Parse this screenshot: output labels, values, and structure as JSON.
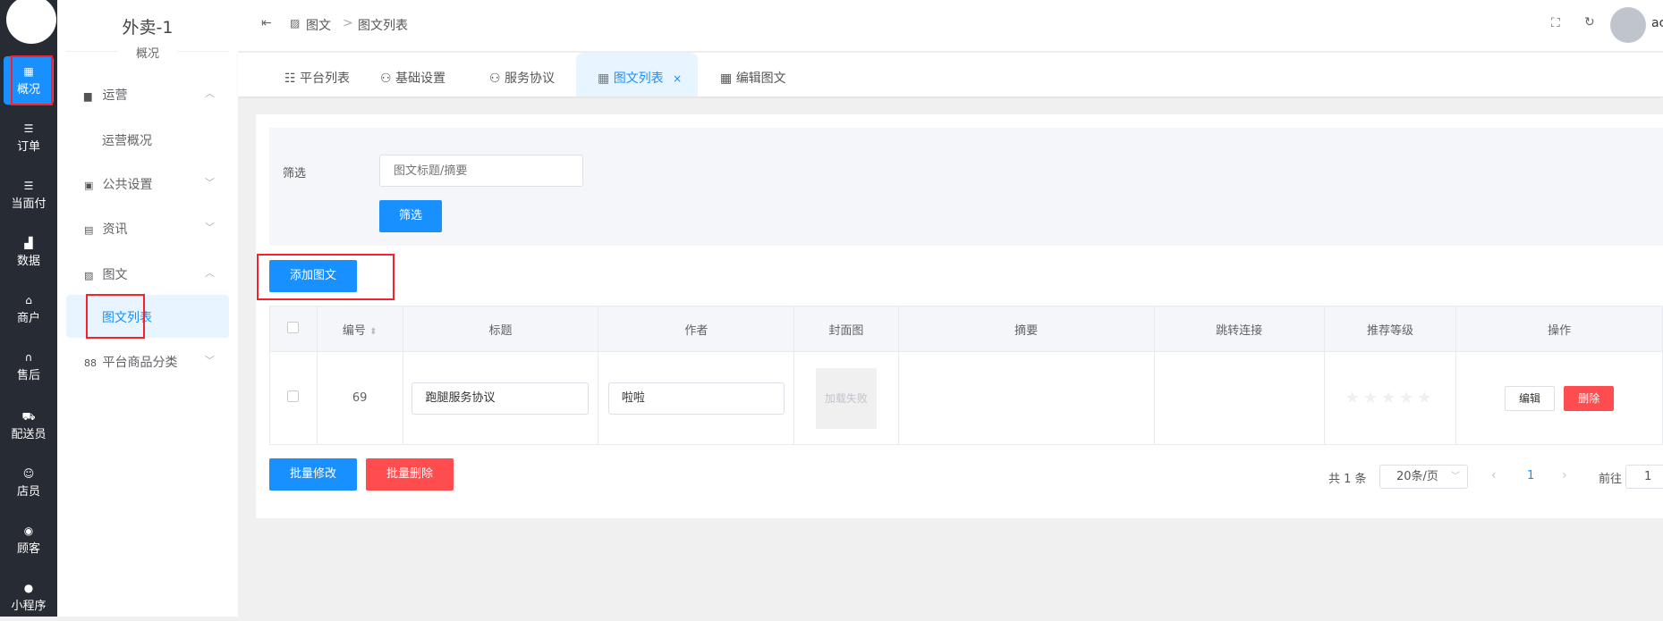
{
  "nav": {
    "items": [
      {
        "label": "概况",
        "icon": "dashboard-icon"
      },
      {
        "label": "订单",
        "icon": "list-icon"
      },
      {
        "label": "当面付",
        "icon": "list-icon"
      },
      {
        "label": "数据",
        "icon": "bar-chart-icon"
      },
      {
        "label": "商户",
        "icon": "shop-icon"
      },
      {
        "label": "售后",
        "icon": "headset-icon"
      },
      {
        "label": "配送员",
        "icon": "delivery-icon"
      },
      {
        "label": "店员",
        "icon": "staff-icon"
      },
      {
        "label": "顾客",
        "icon": "customer-icon"
      },
      {
        "label": "小程序",
        "icon": "wechat-icon"
      }
    ]
  },
  "sub": {
    "title": "外卖-1",
    "subtitle": "概况",
    "menu": [
      {
        "label": "运营"
      },
      {
        "label": "运营概况"
      },
      {
        "label": "公共设置"
      },
      {
        "label": "资讯"
      },
      {
        "label": "图文"
      },
      {
        "label": "图文列表"
      },
      {
        "label": "平台商品分类"
      }
    ]
  },
  "header": {
    "breadcrumb": [
      "图文",
      "图文列表"
    ],
    "sep": ">",
    "user": "ac"
  },
  "tabs": [
    {
      "label": "平台列表"
    },
    {
      "label": "基础设置"
    },
    {
      "label": "服务协议"
    },
    {
      "label": "图文列表",
      "close": "×"
    },
    {
      "label": "编辑图文"
    }
  ],
  "filter": {
    "label": "筛选",
    "placeholder": "图文标题/摘要",
    "button": "筛选"
  },
  "add_button": "添加图文",
  "table": {
    "columns": [
      "编号",
      "标题",
      "作者",
      "封面图",
      "摘要",
      "跳转连接",
      "推荐等级",
      "操作"
    ],
    "rows": [
      {
        "id": "69",
        "title": "跑腿服务协议",
        "author": "啦啦",
        "cover": "加载失败",
        "summary": "",
        "link": "",
        "rating": 0,
        "edit": "编辑",
        "delete": "删除"
      }
    ]
  },
  "bulk": {
    "edit": "批量修改",
    "delete": "批量删除"
  },
  "pagination": {
    "total": "共 1 条",
    "page_size": "20条/页",
    "current": "1",
    "goto_label": "前往",
    "goto_value": "1"
  },
  "colors": {
    "primary": "#1890ff",
    "danger": "#ff4d4f",
    "sidebar": "#272b34"
  }
}
